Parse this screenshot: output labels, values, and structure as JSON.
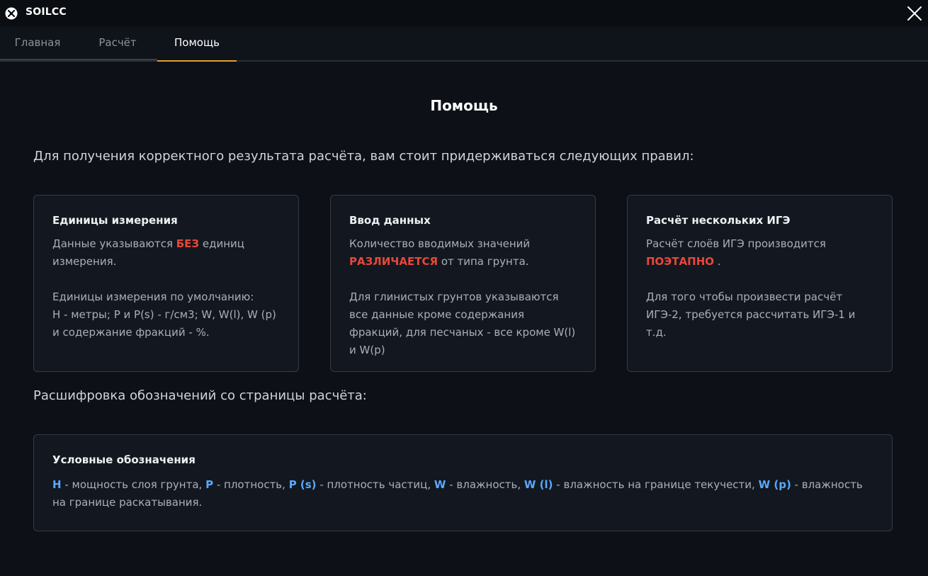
{
  "app": {
    "title": "SOILCC"
  },
  "tabs": [
    {
      "label": "Главная"
    },
    {
      "label": "Расчёт"
    },
    {
      "label": "Помощь"
    }
  ],
  "main": {
    "title": "Помощь",
    "intro": "Для получения корректного результата расчёта, вам стоит придерживаться следующих правил:",
    "cards": [
      {
        "title": "Единицы измерения",
        "p1_pre": "Данные указываются ",
        "p1_em": "БЕЗ",
        "p1_post": " единиц измерения.",
        "p2_line1": "Единицы измерения по умолчанию:",
        "p2_line2": "H - метры; P и P(s) - г/см3; W, W(l), W (p) и содержание фракций - %."
      },
      {
        "title": "Ввод данных",
        "p1_pre": "Количество вводимых значений ",
        "p1_em": "РАЗЛИЧАЕТСЯ",
        "p1_post": " от типа грунта.",
        "p2": "Для глинистых грунтов указываются все данные кроме содержания фракций, для песчаных - все кроме W(l) и W(p)"
      },
      {
        "title": "Расчёт нескольких ИГЭ",
        "p1_pre": "Расчёт слоёв ИГЭ производится ",
        "p1_em": "ПОЭТАПНО",
        "p1_post": " .",
        "p2": "Для того чтобы произвести расчёт ИГЭ-2, требуется рассчитать ИГЭ-1 и т.д."
      }
    ],
    "legend_intro": "Расшифровка обозначений со страницы расчёта:",
    "legend": {
      "title": "Условные обозначения",
      "items": [
        {
          "sym": "H",
          "desc": " - мощность слоя грунта, "
        },
        {
          "sym": "P",
          "desc": " - плотность, "
        },
        {
          "sym": "P (s)",
          "desc": " - плотность частиц, "
        },
        {
          "sym": "W",
          "desc": " - влажность, "
        },
        {
          "sym": "W (l)",
          "desc": " - влажность на границе текучести, "
        },
        {
          "sym": "W (p)",
          "desc": " - влажность на границе раскатывания."
        }
      ]
    }
  },
  "colors": {
    "accent": "#e2a32a",
    "emphasis_red": "#e8473b",
    "symbol_blue": "#5aa9ff"
  }
}
